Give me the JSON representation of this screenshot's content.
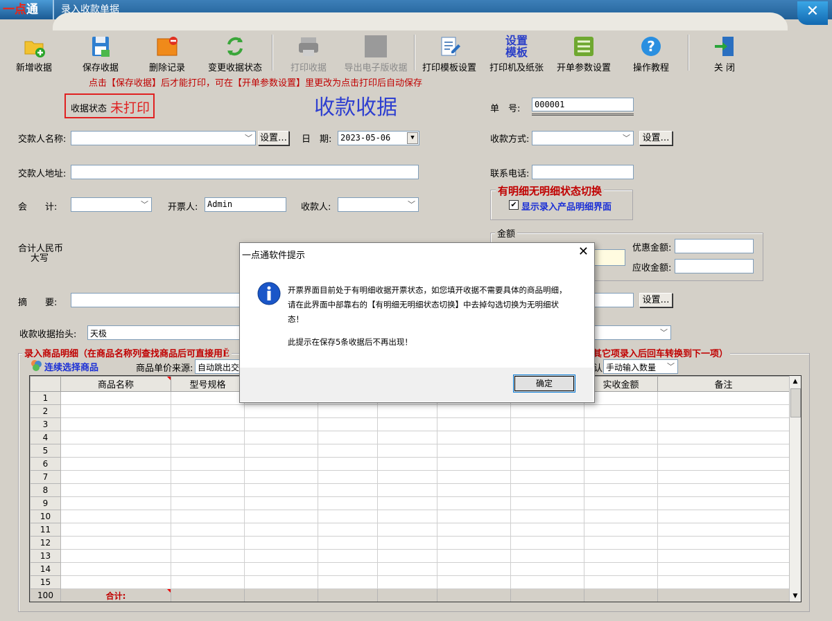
{
  "app": {
    "logo_left": "一点",
    "logo_right": "通",
    "window_title": "录入收款单据",
    "close_glyph": "✕"
  },
  "toolbar": [
    {
      "label": "新增收据",
      "icon": "folder-add-icon",
      "enabled": true
    },
    {
      "label": "保存收据",
      "icon": "floppy-save-icon",
      "enabled": true
    },
    {
      "label": "删除记录",
      "icon": "folder-delete-icon",
      "enabled": true
    },
    {
      "label": "变更收据状态",
      "icon": "refresh-arrows-icon",
      "enabled": true
    },
    {
      "label": "打印收据",
      "icon": "printer-icon",
      "enabled": false
    },
    {
      "label": "导出电子版收据",
      "icon": "export-icon",
      "enabled": false
    },
    {
      "label": "打印模板设置",
      "icon": "template-edit-icon",
      "enabled": true
    },
    {
      "label": "打印机及纸张",
      "icon": "printer-paper-text-icon",
      "icon_text_1": "设置",
      "icon_text_2": "模板",
      "enabled": true
    },
    {
      "label": "开单参数设置",
      "icon": "list-settings-icon",
      "enabled": true
    },
    {
      "label": "操作教程",
      "icon": "help-icon",
      "enabled": true
    },
    {
      "label": "关 闭",
      "icon": "exit-door-icon",
      "enabled": true
    }
  ],
  "hint": "点击【保存收据】后才能打印，可在【开单参数设置】里更改为点击打印后自动保存",
  "status": {
    "label": "收据状态",
    "value": "未打印"
  },
  "doc_title": "收款收据",
  "form": {
    "number_label": "单　号:",
    "number_value": "000001",
    "payer_label": "交款人名称:",
    "payer_value": "",
    "settings_btn": "设置…",
    "date_label": "日　期:",
    "date_value": "2023-05-06",
    "pay_method_label": "收款方式:",
    "pay_method_value": "",
    "address_label": "交款人地址:",
    "address_value": "",
    "phone_label": "联系电话:",
    "phone_value": "",
    "accountant_label": "会　　计:",
    "accountant_value": "",
    "issuer_label": "开票人:",
    "issuer_value": "Admin",
    "receiver_label": "收款人:",
    "receiver_value": "",
    "rmb_label_1": "合计人民币",
    "rmb_label_2": "大写",
    "summary_label": "摘　　要:",
    "summary_value": "",
    "header_label": "收款收据抬头:",
    "header_value": "天极"
  },
  "detail_switch": {
    "title": "有明细无明细状态切换",
    "checkbox_label": "显示录入产品明细界面",
    "checked": true
  },
  "amount": {
    "group_label": "金额",
    "discount_label": "优惠金额:",
    "receivable_label": "应收金额:"
  },
  "details": {
    "title_left": "录入商品明细（在商品名称列查找商品后可直接用Ě",
    "title_right": "其它项录入后回车转换到下一项）",
    "continuous_select": "连续选择商品",
    "price_source_label": "商品单价来源:",
    "price_source_value": "自动跳出交",
    "qty_suffix": "认:",
    "qty_mode_value": "手动输入数量"
  },
  "grid": {
    "columns": [
      "",
      "商品名称",
      "型号规格",
      "",
      "",
      "",
      "",
      "",
      "实收金额",
      "备注"
    ],
    "row_numbers": [
      "1",
      "2",
      "3",
      "4",
      "5",
      "6",
      "7",
      "8",
      "9",
      "10",
      "11",
      "12",
      "13",
      "14",
      "15"
    ],
    "total_row_number": "100",
    "total_label": "合计:"
  },
  "dialog": {
    "title": "一点通软件提示",
    "close_glyph": "✕",
    "message_1": "开票界面目前处于有明细收据开票状态，如您填开收据不需要具体的商品明细，请在此界面中部靠右的【有明细无明细状态切换】中去掉勾选切换为无明细状态！",
    "message_2": "此提示在保存5条收据后不再出现！",
    "ok": "确定"
  },
  "colors": {
    "accent_red": "#c00000",
    "title_blue": "#2e3fd0",
    "window_bg": "#d4d0c8"
  }
}
